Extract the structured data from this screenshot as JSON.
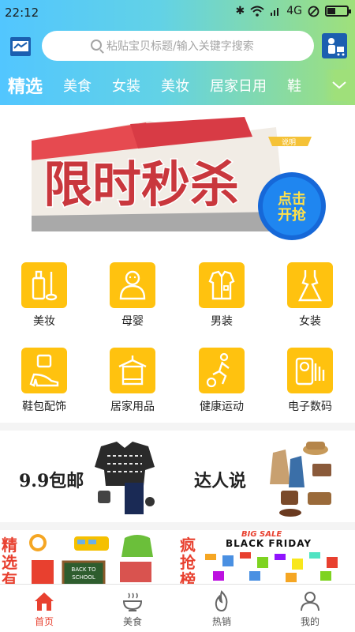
{
  "status_bar": {
    "time": "22:12",
    "network": "4G"
  },
  "search": {
    "placeholder": "粘贴宝贝标题/输入关键字搜索"
  },
  "categories": [
    "精选",
    "美食",
    "女装",
    "美妆",
    "居家日用",
    "鞋"
  ],
  "banner": {
    "title": "限时秒杀",
    "note": "说明",
    "cta": "点击开抢"
  },
  "grid": [
    {
      "label": "美妆",
      "icon": "cosmetics-icon"
    },
    {
      "label": "母婴",
      "icon": "baby-icon"
    },
    {
      "label": "男装",
      "icon": "shirt-icon"
    },
    {
      "label": "女装",
      "icon": "dress-icon"
    },
    {
      "label": "鞋包配饰",
      "icon": "high-heel-icon"
    },
    {
      "label": "居家用品",
      "icon": "towel-icon"
    },
    {
      "label": "健康运动",
      "icon": "sports-icon"
    },
    {
      "label": "电子数码",
      "icon": "camera-icon"
    }
  ],
  "promos": [
    {
      "label": "9.9包邮"
    },
    {
      "label": "达人说"
    }
  ],
  "row3": {
    "left_label": "精选有",
    "right_label": "疯抢榜",
    "sale_tag": "BIG SALE",
    "sale_text": "BLACK FRIDAY",
    "school_text": "BACK TO SCHOOL"
  },
  "tabs": [
    {
      "label": "首页",
      "icon": "home-icon",
      "active": true
    },
    {
      "label": "美食",
      "icon": "bowl-icon",
      "active": false
    },
    {
      "label": "热销",
      "icon": "fire-icon",
      "active": false
    },
    {
      "label": "我的",
      "icon": "user-icon",
      "active": false
    }
  ],
  "colors": {
    "accent": "#e8402f",
    "grid_icon_bg": "#ffc20f",
    "gradient_start": "#52c6ff",
    "gradient_end": "#9fe07a"
  }
}
